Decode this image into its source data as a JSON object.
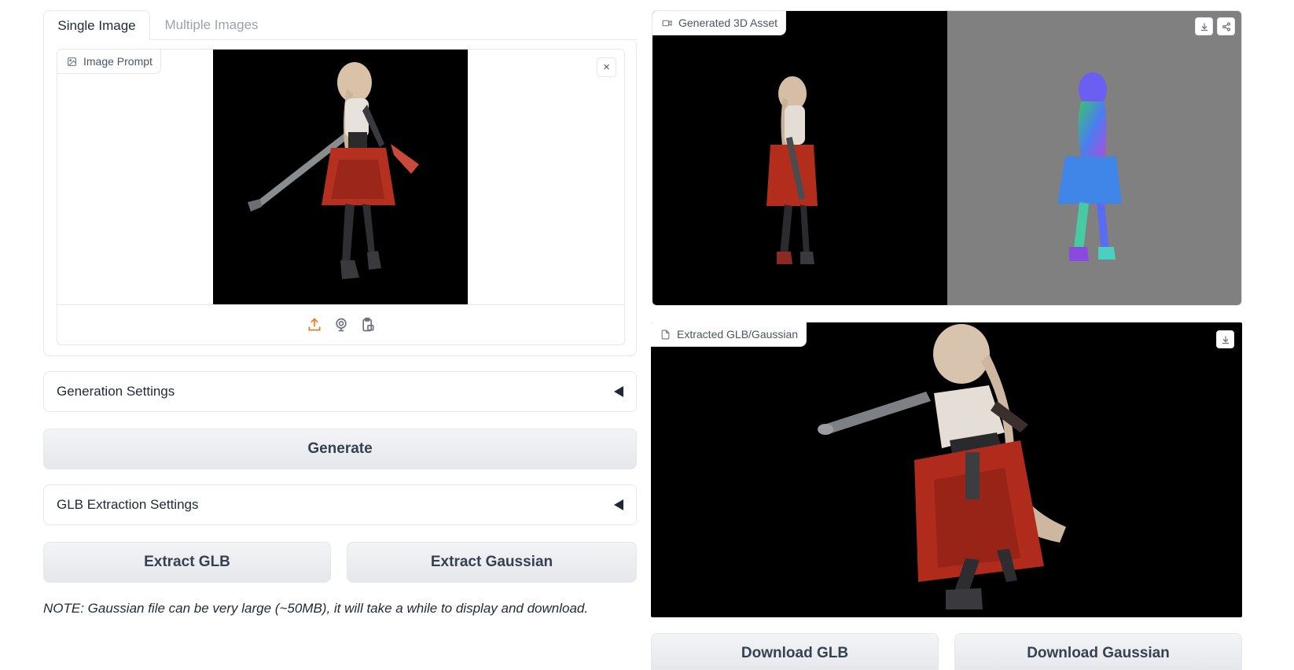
{
  "tabs": [
    {
      "label": "Single Image",
      "active": true
    },
    {
      "label": "Multiple Images",
      "active": false
    }
  ],
  "image_prompt": {
    "label": "Image Prompt",
    "close_symbol": "×",
    "source_icons": [
      "upload-icon",
      "webcam-icon",
      "clipboard-icon"
    ]
  },
  "generation_settings": {
    "label": "Generation Settings"
  },
  "generate_button": {
    "label": "Generate"
  },
  "glb_settings": {
    "label": "GLB Extraction Settings"
  },
  "extract_glb_button": {
    "label": "Extract GLB"
  },
  "extract_gaussian_button": {
    "label": "Extract Gaussian"
  },
  "note": "NOTE: Gaussian file can be very large (~50MB), it will take a while to display and download.",
  "video_output": {
    "label": "Generated 3D Asset",
    "left_bg": "#000000",
    "right_bg": "#808080"
  },
  "model_output": {
    "label": "Extracted GLB/Gaussian",
    "bg": "#000000"
  },
  "download_glb_button": {
    "label": "Download GLB"
  },
  "download_gaussian_button": {
    "label": "Download Gaussian"
  },
  "colors": {
    "accent": "#f97316",
    "border": "#e5e7eb",
    "text": "#1f2937",
    "muted": "#9ca3af"
  }
}
